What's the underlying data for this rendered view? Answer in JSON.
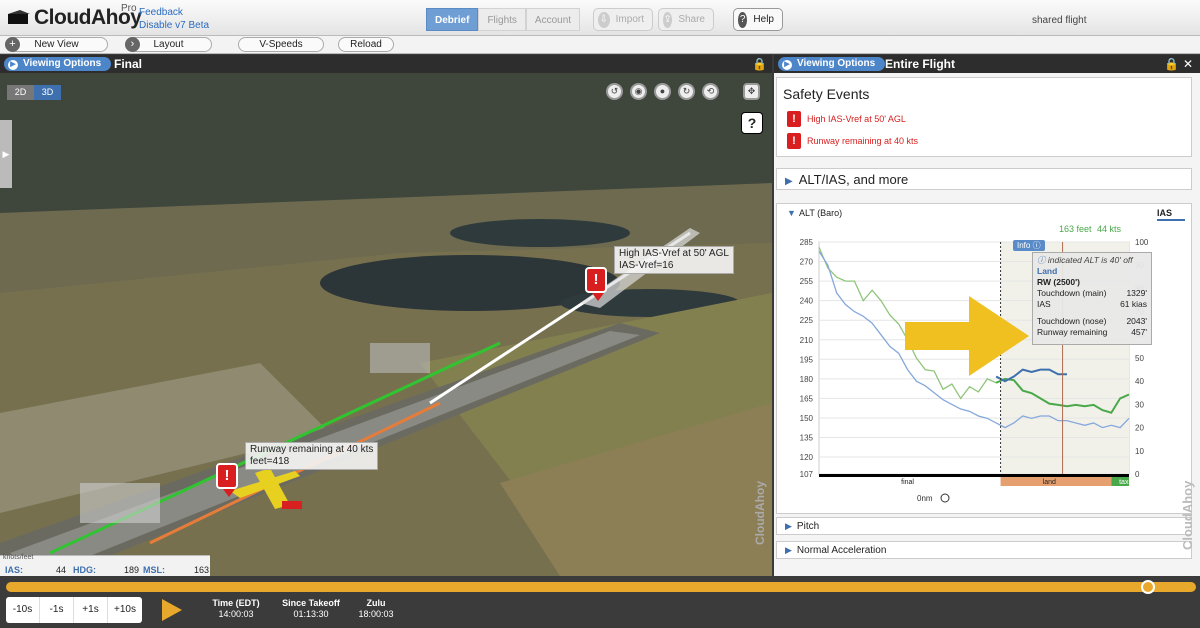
{
  "app": {
    "brand": "CloudAhoy",
    "tier": "Pro",
    "links": [
      "Feedback",
      "Disable v7 Beta"
    ]
  },
  "nav": {
    "tabs": [
      "Debrief",
      "Flights",
      "Account"
    ],
    "active": "Debrief",
    "import_label": "Import",
    "share_label": "Share",
    "help_label": "Help",
    "shared_label": "shared flight"
  },
  "toolbar": {
    "new_view": "New View",
    "layout": "Layout",
    "vspeeds": "V-Speeds",
    "reload": "Reload"
  },
  "left_panel": {
    "viewing_options": "Viewing Options",
    "title": "Final",
    "btn_2d": "2D",
    "btn_3d": "3D",
    "help": "?",
    "callout1": [
      "High IAS-Vref at 50' AGL",
      "IAS-Vref=16"
    ],
    "callout2": [
      "Runway remaining at 40 kts",
      "feet=418"
    ],
    "readout": {
      "unit_label": "knots/feet",
      "ias_label": "IAS:",
      "ias": "44",
      "hdg_label": "HDG:",
      "hdg": "189",
      "msl_label": "MSL:",
      "msl": "163"
    },
    "watermark": "CloudAhoy"
  },
  "right_panel": {
    "viewing_options": "Viewing Options",
    "title": "Entire Flight",
    "safety": {
      "title": "Safety Events",
      "events": [
        "High IAS-Vref at 50' AGL",
        "Runway remaining at 40 kts"
      ]
    },
    "alt_section": "ALT/IAS, and more",
    "chart_header": {
      "alt_label": "ALT (Baro)",
      "ias_label": "IAS",
      "cursor_readout_alt": "163 feet",
      "cursor_readout_ias": "44 kts",
      "info_label": "Info"
    },
    "info_box": {
      "note": "indicated ALT is 40' off",
      "phase": "Land",
      "runway": "RW",
      "runway_len": "(2500')",
      "rows": [
        [
          "Touchdown (main)",
          "1329'"
        ],
        [
          "IAS",
          "61 kias"
        ],
        [
          "Touchdown (nose)",
          "2043'"
        ],
        [
          "Runway remaining",
          "457'"
        ]
      ]
    },
    "phase_labels": {
      "final": "final",
      "land": "land",
      "taxi": "taxi"
    },
    "distance_label": "0nm",
    "sections": [
      "Pitch",
      "Normal Acceleration"
    ],
    "watermark": "CloudAhoy"
  },
  "timeline": {
    "steps": [
      "-10s",
      "-1s",
      "+1s",
      "+10s"
    ],
    "progress": 0.96,
    "time_label": "Time (EDT)",
    "time": "14:00:03",
    "since_label": "Since Takeoff",
    "since": "01:13:30",
    "zulu_label": "Zulu",
    "zulu": "18:00:03"
  },
  "chart_data": {
    "type": "line",
    "x": [
      0,
      1,
      2,
      3,
      4,
      5,
      6,
      7,
      8,
      9,
      10,
      11,
      12,
      13,
      14,
      15,
      16,
      17,
      18,
      19,
      20,
      21,
      22,
      23,
      24,
      25,
      26,
      27,
      28,
      29,
      30,
      31,
      32,
      33,
      34,
      35
    ],
    "series": [
      {
        "name": "ALT (Baro)",
        "axis": "left",
        "values": [
          281,
          265,
          258,
          255,
          255,
          240,
          248,
          240,
          229,
          222,
          210,
          196,
          187,
          186,
          172,
          176,
          165,
          174,
          170,
          180,
          177,
          180,
          179,
          171,
          169,
          165,
          161,
          160,
          159,
          160,
          159,
          160,
          156,
          154,
          165,
          168
        ]
      },
      {
        "name": "IAS",
        "axis": "right",
        "values": [
          96,
          90,
          78,
          73,
          70,
          68,
          65,
          60,
          55,
          52,
          45,
          40,
          38,
          35,
          32,
          30,
          28,
          27,
          25,
          24,
          22,
          20,
          22,
          25,
          24,
          25,
          25,
          23,
          23,
          22,
          21,
          22,
          20,
          21,
          20,
          24
        ]
      }
    ],
    "ylim_left": [
      107,
      285
    ],
    "yticks_left": [
      107,
      120,
      135,
      150,
      165,
      180,
      195,
      210,
      225,
      240,
      255,
      270,
      285
    ],
    "ylim_right": [
      0,
      100
    ],
    "yticks_right": [
      0,
      10,
      20,
      30,
      40,
      50,
      60,
      70,
      80,
      90,
      100
    ],
    "cursor": {
      "alt": 163,
      "ias": 44
    },
    "grid": true
  }
}
